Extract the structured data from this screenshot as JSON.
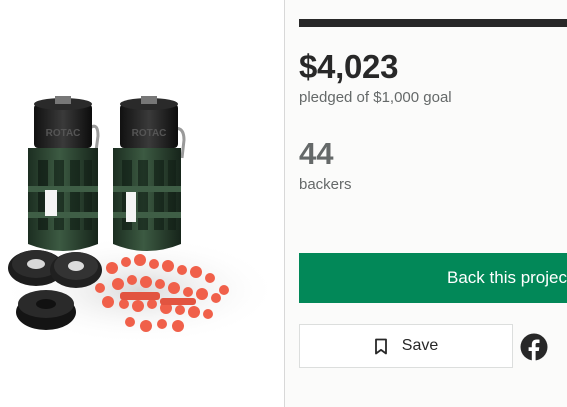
{
  "campaign": {
    "pledged_amount": "$4,023",
    "pledged_caption": "pledged of $1,000 goal",
    "progress_percent": 100,
    "backers_count": "44",
    "backers_caption": "backers"
  },
  "actions": {
    "back_label": "Back this project",
    "save_label": "Save"
  },
  "product": {
    "embossed_text": "ROTAC"
  },
  "colors": {
    "primary_green": "#028858",
    "text_dark": "#282828",
    "text_muted": "#656969",
    "facebook": "#282828",
    "canister_green": "#2f4a34",
    "accessory_orange": "#f0604a"
  },
  "icons": {
    "save": "bookmark-icon",
    "share": "facebook-icon"
  }
}
